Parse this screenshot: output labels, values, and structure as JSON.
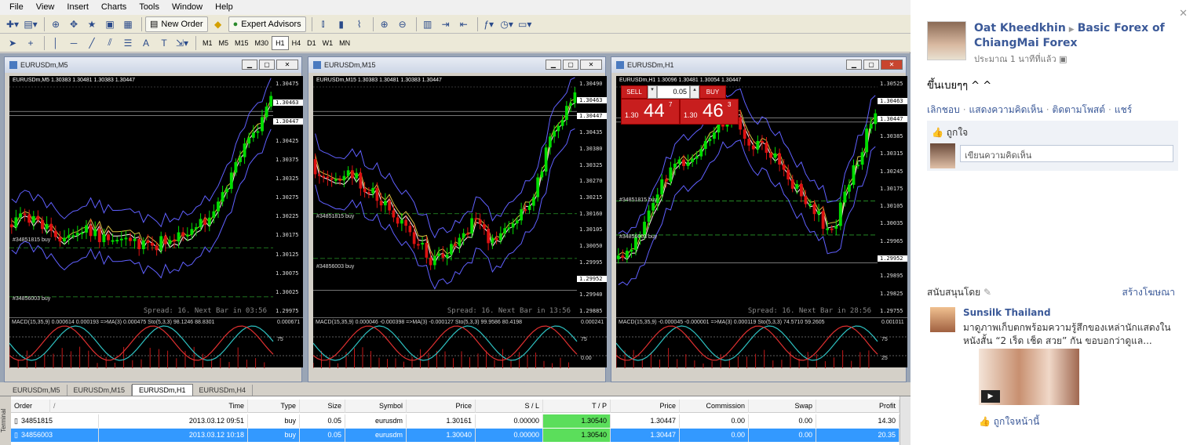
{
  "menu": [
    "File",
    "View",
    "Insert",
    "Charts",
    "Tools",
    "Window",
    "Help"
  ],
  "toolbar": {
    "new_order": "New Order",
    "expert_advisors": "Expert Advisors"
  },
  "timeframes": [
    "M1",
    "M5",
    "M15",
    "M30",
    "H1",
    "H4",
    "D1",
    "W1",
    "MN"
  ],
  "active_timeframe": "H1",
  "charts": [
    {
      "title": "EURUSDm,M5",
      "header": "EURUSDm,M5  1.30383 1.30481 1.30383 1.30447",
      "prices": [
        "1.30475",
        "1.30463",
        "1.30447",
        "1.30425",
        "1.30375",
        "1.30325",
        "1.30275",
        "1.30225",
        "1.30175",
        "1.30125",
        "1.30075",
        "1.30025",
        "1.29975"
      ],
      "spread": "Spread: 16. Next Bar in 03:56",
      "orders": [
        "#34851815 buy",
        "#34856003 buy"
      ],
      "macd": "MACD(15,35,9) 0.000614 0.000193 =>MA(3) 0.000475 Sto(5,3,3) 98.1246 88.8301",
      "macd_axis": [
        "0.000671",
        "75"
      ]
    },
    {
      "title": "EURUSDm,M15",
      "header": "EURUSDm,M15  1.30383 1.30481 1.30383 1.30447",
      "prices": [
        "1.30490",
        "1.30463",
        "1.30447",
        "1.30435",
        "1.30380",
        "1.30325",
        "1.30270",
        "1.30215",
        "1.30160",
        "1.30105",
        "1.30050",
        "1.29995",
        "1.29952",
        "1.29940",
        "1.29885"
      ],
      "spread": "Spread: 16. Next Bar in 13:56",
      "orders": [
        "#34851815 buy",
        "#34856003 buy"
      ],
      "macd": "MACD(15,35,9) 0.000046 -0.000398 =>MA(3) -0.000127 Sto(5,3,3) 99.9586 80.4198",
      "macd_axis": [
        "0.000241",
        "75",
        "0.00"
      ]
    },
    {
      "title": "EURUSDm,H1",
      "header": "EURUSDm,H1  1.30096 1.30481 1.30054 1.30447",
      "prices": [
        "1.30525",
        "1.30463",
        "1.30447",
        "1.30385",
        "1.30315",
        "1.30245",
        "1.30175",
        "1.30105",
        "1.30035",
        "1.29965",
        "1.29952",
        "1.29895",
        "1.29825",
        "1.29755"
      ],
      "spread": "Spread: 16. Next Bar in 28:56",
      "orders": [
        "#34851815 buy",
        "#34856003 buy"
      ],
      "macd": "MACD(15,35,9) -0.000045 -0.000001 =>MA(3) 0.000119 Sto(5,3,3) 74.5710 59.2605",
      "macd_axis": [
        "0.001011",
        "75",
        "25"
      ],
      "oneclick": {
        "sell": "SELL",
        "buy": "BUY",
        "lot": "0.05",
        "sell_prefix": "1.30",
        "sell_big": "44",
        "sell_sup": "7",
        "buy_prefix": "1.30",
        "buy_big": "46",
        "buy_sup": "3"
      }
    }
  ],
  "chart_tabs": [
    "EURUSDm,M5",
    "EURUSDm,M15",
    "EURUSDm,H1",
    "EURUSDm,H4"
  ],
  "active_tab": "EURUSDm,H1",
  "terminal": {
    "side_label": "Terminal",
    "columns": [
      "Order",
      "/",
      "Time",
      "Type",
      "Size",
      "Symbol",
      "Price",
      "S / L",
      "T / P",
      "Price",
      "Commission",
      "Swap",
      "Profit"
    ],
    "rows": [
      [
        "34851815",
        "2013.03.12 09:51",
        "buy",
        "0.05",
        "eurusdm",
        "1.30161",
        "0.00000",
        "1.30540",
        "1.30447",
        "0.00",
        "0.00",
        "14.30"
      ],
      [
        "34856003",
        "2013.03.12 10:18",
        "buy",
        "0.05",
        "eurusdm",
        "1.30040",
        "0.00000",
        "1.30540",
        "1.30447",
        "0.00",
        "0.00",
        "20.35"
      ]
    ]
  },
  "facebook": {
    "author": "Oat Kheedkhin",
    "page": "Basic Forex of ChiangMai Forex",
    "time": "ประมาณ 1 นาทีที่แล้ว",
    "post": "ขึ้นเบยๆๆ ^ ^",
    "actions": [
      "เลิกชอบ",
      "แสดงความคิดเห็น",
      "ติดตามโพสต์",
      "แชร์"
    ],
    "like_text": "ถูกใจ",
    "comment_placeholder": "เขียนความคิดเห็น",
    "sponsored": "สนับสนุนโดย",
    "create_ad": "สร้างโฆษณา",
    "ad_title": "Sunsilk Thailand",
    "ad_desc": "มาดูภาพเก็บตกพร้อมความรู้สึกของเหล่านักแสดงในหนังสั้น “2 เร็ด เช็ด สวย” กัน ขอบอกว่าดูแล...",
    "ad_like": "ถูกใจหน้านี้"
  },
  "colors": {
    "bull": "#00dd00",
    "bear": "#dd1111",
    "sell_btn": "#c81e1e",
    "selected_row": "#3399ff",
    "tp_cell": "#5bde5b",
    "fb_link": "#3b5998"
  }
}
